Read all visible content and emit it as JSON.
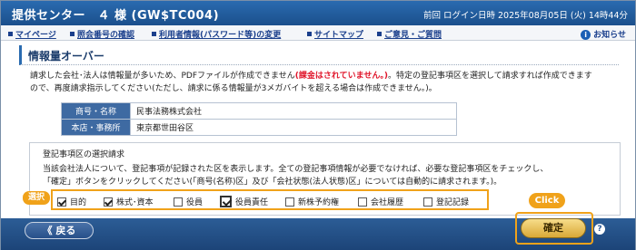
{
  "header": {
    "title": "提供センター　４ 様 (GW$TC004)",
    "last_login": "前回 ログイン日時 2025年08月05日 (火) 14時44分"
  },
  "menu": [
    {
      "label": "マイページ"
    },
    {
      "label": "照会番号の確認"
    },
    {
      "label": "利用者情報(パスワード等)の変更"
    },
    {
      "label": "サイトマップ"
    },
    {
      "label": "ご意見・ご質問"
    }
  ],
  "notice": "お知らせ",
  "section_title": "情報量オーバー",
  "message": {
    "part1": "請求した会社･法人は情報量が多いため、PDFファイルが作成できません",
    "red": "(課金はされていません。)",
    "part2": "。特定の登記事項区を選択して請求すれば作成できます",
    "line2": "ので、再度請求指示してください(ただし、請求に係る情報量が3メガバイトを超える場合は作成できません。)。"
  },
  "company": {
    "name_label": "商号・名称",
    "name_value": "民事法務株式会社",
    "office_label": "本店・事務所",
    "office_value": "東京都世田谷区"
  },
  "selection": {
    "title": "登記事項区の選択請求",
    "desc_line1": "当該会社法人について、登記事項が記録された区を表示します。全ての登記事項情報が必要でなければ、必要な登記事項区をチェックし、",
    "desc_line2": "「確定」ボタンをクリックしてください(「商号(名称)区」及び「会社状態(法人状態)区」については自動的に請求されます。)。",
    "badge": "選択",
    "options": [
      {
        "label": "目的",
        "checked": true
      },
      {
        "label": "株式･資本",
        "checked": true
      },
      {
        "label": "役員",
        "checked": false
      },
      {
        "label": "役員責任",
        "checked": true
      },
      {
        "label": "新株予約権",
        "checked": false
      },
      {
        "label": "会社履歴",
        "checked": false
      },
      {
        "label": "登記記録",
        "checked": false
      }
    ]
  },
  "footer": {
    "back_label": "《 戻る",
    "click_badge": "Click",
    "confirm_label": "確定",
    "help": "?"
  }
}
